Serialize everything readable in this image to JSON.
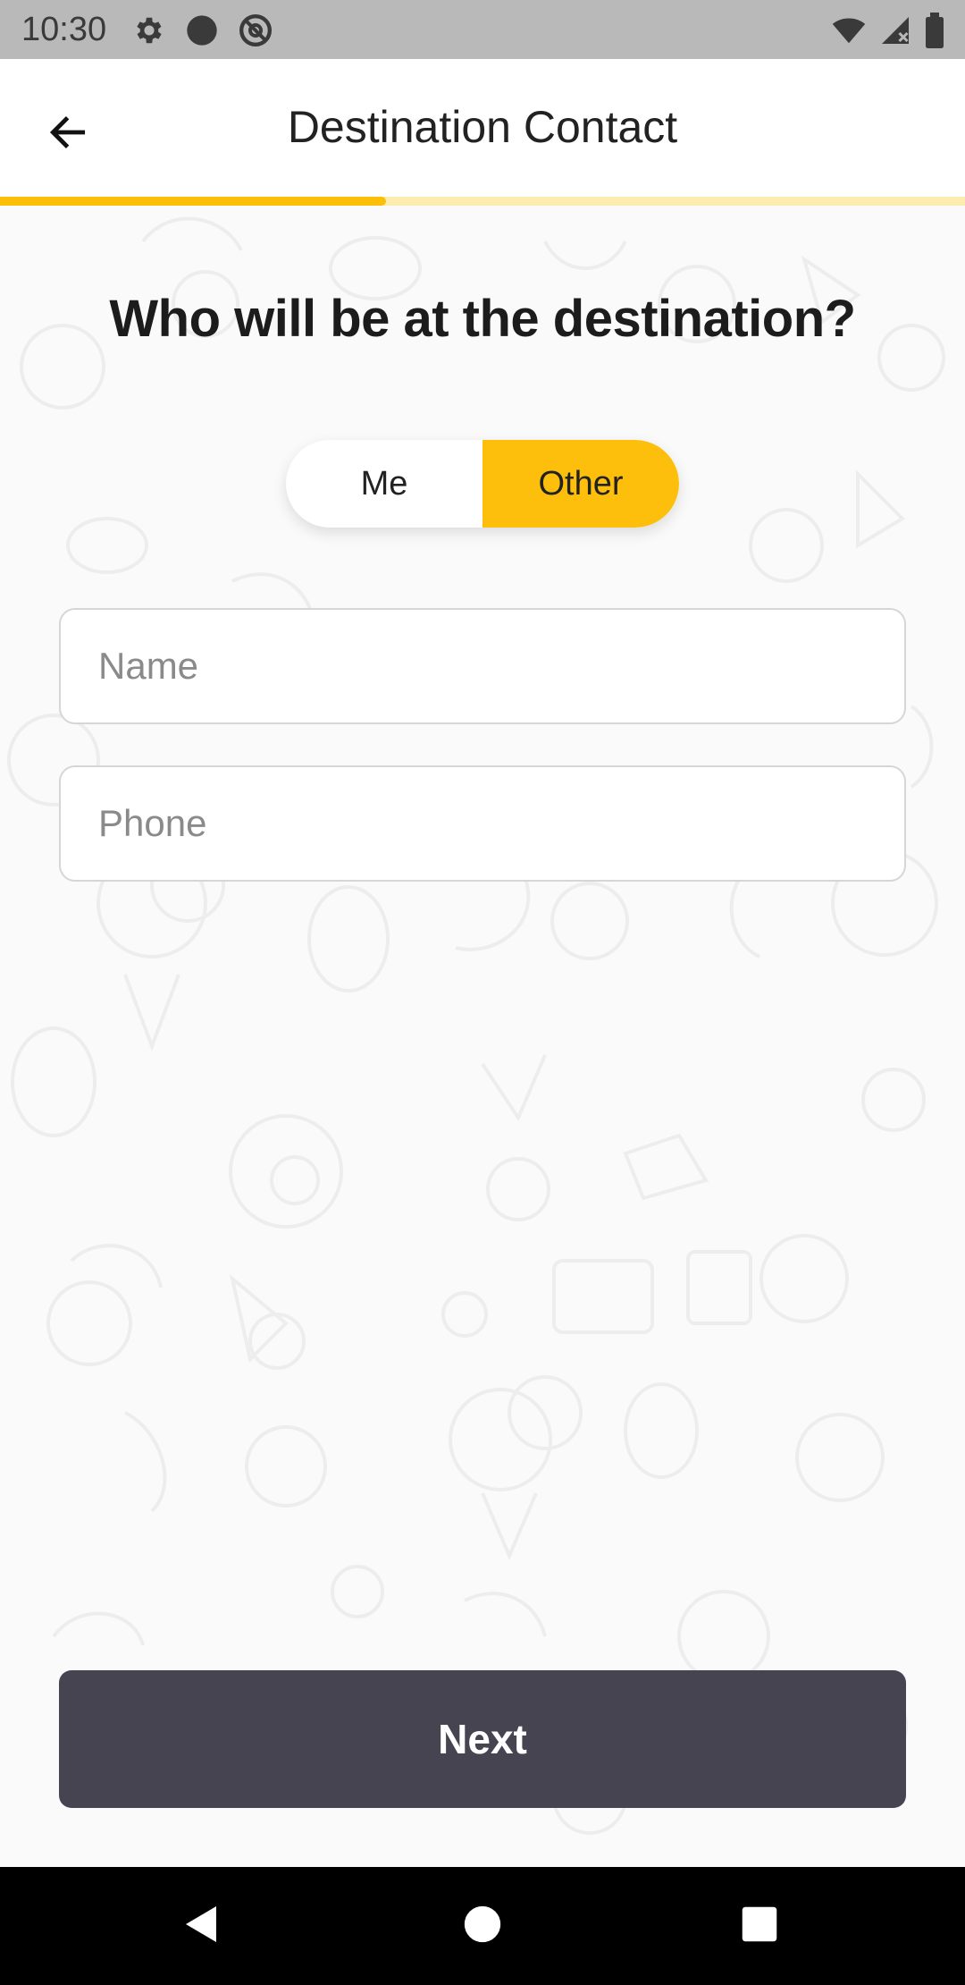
{
  "status_bar": {
    "time": "10:30",
    "left_icons": [
      "settings-icon",
      "circle-icon",
      "at-sign-icon"
    ],
    "right_icons": [
      "wifi-icon",
      "signal-icon",
      "battery-icon"
    ]
  },
  "header": {
    "title": "Destination Contact",
    "back_icon": "arrow-left-icon"
  },
  "progress": {
    "value": 0.4,
    "fill_color": "#fbbf0a",
    "track_color": "#fdecb0"
  },
  "main": {
    "question": "Who will be at the destination?",
    "toggle": {
      "options": [
        "Me",
        "Other"
      ],
      "selected": "Other",
      "accent_color": "#fdbe0c"
    },
    "name_field": {
      "placeholder": "Name",
      "value": ""
    },
    "phone_field": {
      "placeholder": "Phone",
      "value": ""
    }
  },
  "footer": {
    "next_label": "Next",
    "button_color": "#464451"
  },
  "nav_bar": {
    "icons": [
      "back-triangle-icon",
      "home-circle-icon",
      "recents-square-icon"
    ]
  }
}
